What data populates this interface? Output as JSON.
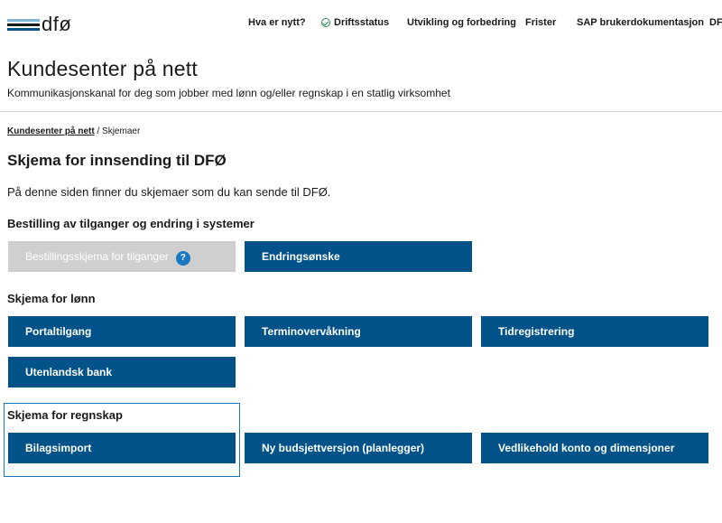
{
  "logo": {
    "text": "dfø"
  },
  "nav": {
    "items": [
      {
        "label": "Hva er nytt?"
      },
      {
        "label": "Driftsstatus"
      },
      {
        "label": "Utvikling og forbedring"
      },
      {
        "label": "Frister"
      },
      {
        "label": "SAP brukerdokumentasjon"
      },
      {
        "label": "DF"
      }
    ]
  },
  "header": {
    "title": "Kundesenter på nett",
    "subtitle": "Kommunikasjonskanal for deg som jobber med lønn og/eller regnskap i en statlig virksomhet"
  },
  "breadcrumb": {
    "home": "Kundesenter på nett",
    "separator": " / ",
    "current": "Skjemaer"
  },
  "main": {
    "title": "Skjema for innsending til DFØ",
    "intro": "På denne siden finner du skjemaer som du kan sende til DFØ.",
    "sections": [
      {
        "heading": "Bestilling av tilganger og endring i systemer",
        "buttons": [
          {
            "label": "Bestillingsskjema for tilganger",
            "help": "?"
          },
          {
            "label": "Endringsønske"
          }
        ]
      },
      {
        "heading": "Skjema for lønn",
        "buttons": [
          {
            "label": "Portaltilgang"
          },
          {
            "label": "Terminovervåkning"
          },
          {
            "label": "Tidregistrering"
          },
          {
            "label": "Utenlandsk bank"
          }
        ]
      },
      {
        "heading": "Skjema for regnskap",
        "buttons": [
          {
            "label": "Bilagsimport"
          },
          {
            "label": "Ny budsjettversjon (planlegger)"
          },
          {
            "label": "Vedlikehold konto og dimensjoner"
          }
        ]
      }
    ]
  },
  "colors": {
    "button_bg": "#005289",
    "button_disabled_bg": "#cfcfcf",
    "focus_outline": "#1a78c2",
    "status_ok": "#2e8b57"
  },
  "icons": {
    "status": "check-circle-icon",
    "help": "question-circle-icon"
  }
}
